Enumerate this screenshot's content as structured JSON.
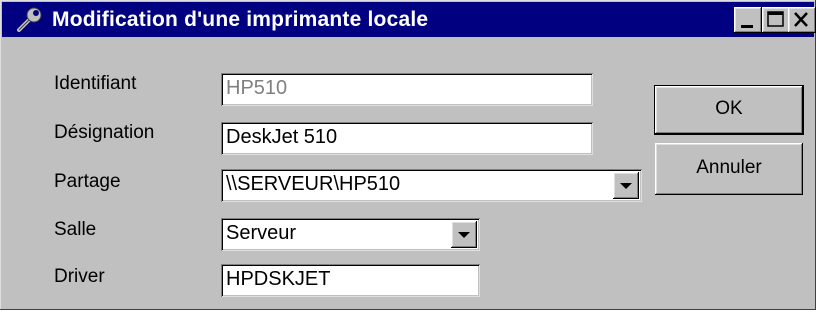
{
  "window": {
    "title": "Modification d'une imprimante locale",
    "icon": "printer-settings-icon",
    "controls": [
      "minimize-icon",
      "maximize-icon",
      "close-icon"
    ]
  },
  "form": {
    "identifiant": {
      "label": "Identifiant",
      "value": "HP510"
    },
    "designation": {
      "label": "Désignation",
      "value": "DeskJet 510"
    },
    "partage": {
      "label": "Partage",
      "value": "\\\\SERVEUR\\HP510"
    },
    "salle": {
      "label": "Salle",
      "value": "Serveur"
    },
    "driver": {
      "label": "Driver",
      "value": "HPDSKJET"
    }
  },
  "buttons": {
    "ok": "OK",
    "cancel": "Annuler"
  },
  "colors": {
    "titlebar": "#000080",
    "face": "#c0c0c0",
    "disabled_text": "#808080"
  }
}
